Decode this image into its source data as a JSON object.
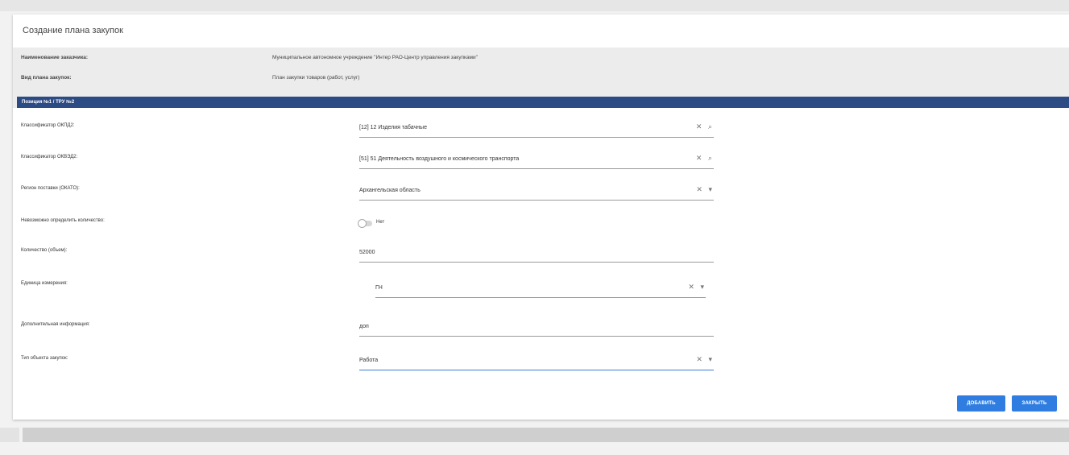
{
  "dialog": {
    "title": "Создание плана закупок"
  },
  "info": {
    "customer_label": "Наименование заказчика:",
    "customer_value": "Муниципальное автономное учреждение \"Интер РАО-Центр управления закупками\"",
    "plan_type_label": "Вид плана закупок:",
    "plan_type_value": "План закупки товаров (работ, услуг)"
  },
  "section": {
    "title": "Позиция №1 / ТРУ №2"
  },
  "form": {
    "okpd_label": "Классификатор ОКПД2:",
    "okpd_value": "[12] 12 Изделия табачные",
    "okved_label": "Классификатор ОКВЭД2:",
    "okved_value": "[51] 51 Деятельность воздушного и космического транспорта",
    "region_label": "Регион поставки (ОКАТО):",
    "region_value": "Архангельская область",
    "no_quantity_label": "Невозможно определить количество:",
    "no_quantity_toggle": "Нет",
    "no_quantity_state": false,
    "quantity_label": "Количество (объем):",
    "quantity_value": "52000",
    "unit_label": "Единица измерения:",
    "unit_value": "ГН",
    "extra_label": "Дополнительная информация:",
    "extra_value": "доп",
    "object_type_label": "Тип объекта закупок:",
    "object_type_value": "Работа"
  },
  "icons": {
    "clear": "✕",
    "search": "⌕",
    "dropdown": "▾"
  },
  "buttons": {
    "add": "ДОБАВИТЬ",
    "close": "ЗАКРЫТЬ"
  },
  "colors": {
    "section_bar": "#2c4a84",
    "button": "#2f7de0",
    "active_underline": "#3b7dd8"
  }
}
